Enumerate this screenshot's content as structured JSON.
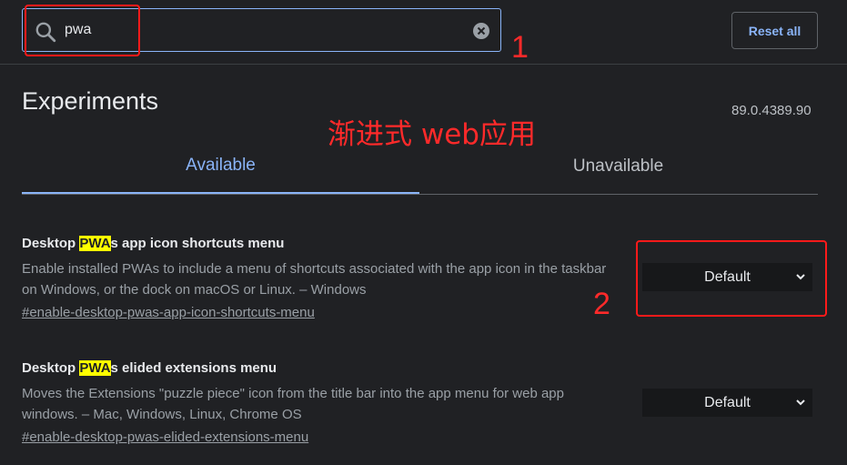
{
  "search": {
    "value": "pwa",
    "placeholder": ""
  },
  "header": {
    "reset_label": "Reset all"
  },
  "page": {
    "title": "Experiments",
    "version": "89.0.4389.90"
  },
  "tabs": [
    {
      "label": "Available",
      "active": true
    },
    {
      "label": "Unavailable",
      "active": false
    }
  ],
  "annotations": {
    "num1": "1",
    "num2": "2",
    "text": "渐进式 web应用"
  },
  "experiments": [
    {
      "name_prefix": "Desktop ",
      "name_highlight": "PWA",
      "name_suffix": "s app icon shortcuts menu",
      "description": "Enable installed PWAs to include a menu of shortcuts associated with the app icon in the taskbar on Windows, or the dock on macOS or Linux. – Windows",
      "link": "#enable-desktop-pwas-app-icon-shortcuts-menu",
      "selected": "Default"
    },
    {
      "name_prefix": "Desktop ",
      "name_highlight": "PWA",
      "name_suffix": "s elided extensions menu",
      "description": "Moves the Extensions \"puzzle piece\" icon from the title bar into the app menu for web app windows. – Mac, Windows, Linux, Chrome OS",
      "link": "#enable-desktop-pwas-elided-extensions-menu",
      "selected": "Default"
    }
  ],
  "colors": {
    "accent": "#8ab4f8",
    "background": "#202124",
    "highlight": "#ffff00",
    "annotation": "#ff1a1a"
  }
}
